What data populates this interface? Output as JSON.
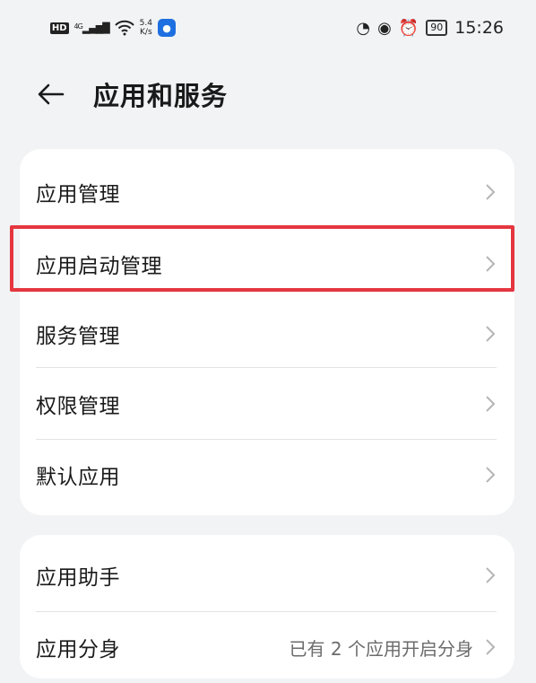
{
  "status_bar": {
    "hd": "HD",
    "network": "4G",
    "speed_value": "5.4",
    "speed_unit": "K/s",
    "battery": "90",
    "time": "15:26"
  },
  "header": {
    "title": "应用和服务"
  },
  "group1": {
    "items": [
      {
        "label": "应用管理"
      },
      {
        "label": "应用启动管理"
      },
      {
        "label": "服务管理"
      },
      {
        "label": "权限管理"
      },
      {
        "label": "默认应用"
      }
    ]
  },
  "group2": {
    "items": [
      {
        "label": "应用助手"
      },
      {
        "label": "应用分身",
        "value": "已有 2 个应用开启分身"
      }
    ]
  },
  "colors": {
    "highlight": "#e5363f",
    "background": "#f1f3f5",
    "card": "#ffffff"
  }
}
